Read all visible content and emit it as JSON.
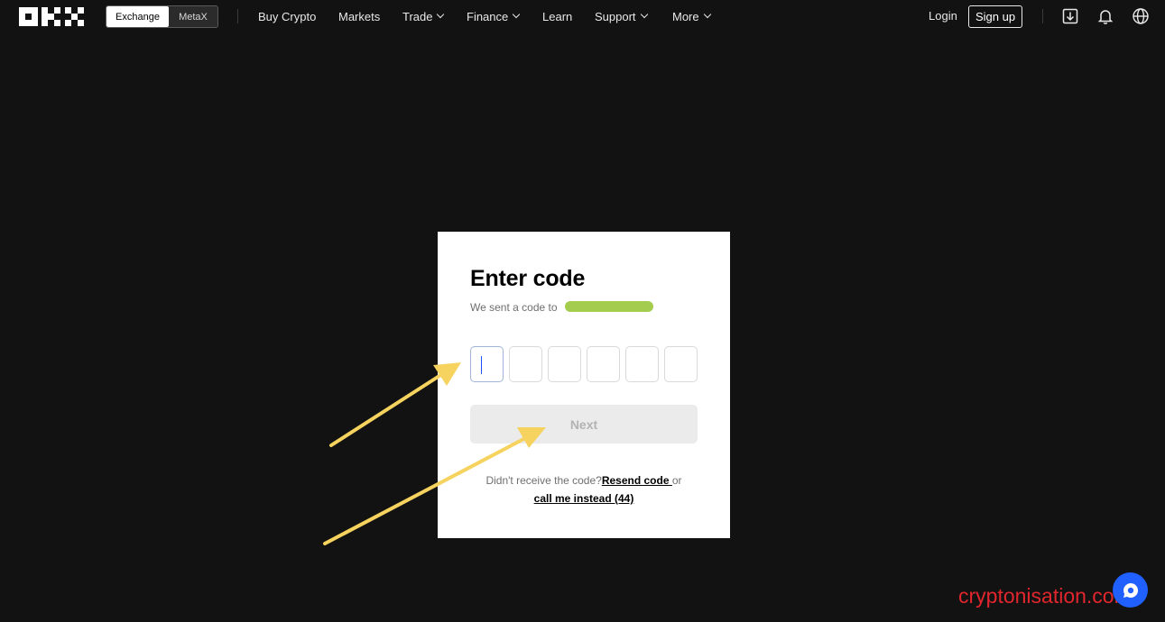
{
  "header": {
    "logo_text": "OKX",
    "segment": {
      "exchange": "Exchange",
      "metax": "MetaX"
    },
    "nav": [
      {
        "label": "Buy Crypto",
        "has_dropdown": false
      },
      {
        "label": "Markets",
        "has_dropdown": false
      },
      {
        "label": "Trade",
        "has_dropdown": true
      },
      {
        "label": "Finance",
        "has_dropdown": true
      },
      {
        "label": "Learn",
        "has_dropdown": false
      },
      {
        "label": "Support",
        "has_dropdown": true
      },
      {
        "label": "More",
        "has_dropdown": true
      }
    ],
    "login": "Login",
    "signup": "Sign up",
    "icons": [
      "download-icon",
      "bell-icon",
      "globe-icon"
    ]
  },
  "card": {
    "title": "Enter code",
    "sent_text": "We sent a code to",
    "code_digits": [
      "",
      "",
      "",
      "",
      "",
      ""
    ],
    "next_label": "Next",
    "didnt_receive": "Didn't receive the code?",
    "resend_label": "Resend code ",
    "or_text": " or",
    "call_label": "call me instead (44)"
  },
  "watermark": "cryptonisation.com",
  "colors": {
    "background": "#121212",
    "card": "#ffffff",
    "arrow": "#f5d35e",
    "redaction": "#a4cc4f",
    "chat": "#1f60ff",
    "watermark": "#e2262d"
  }
}
